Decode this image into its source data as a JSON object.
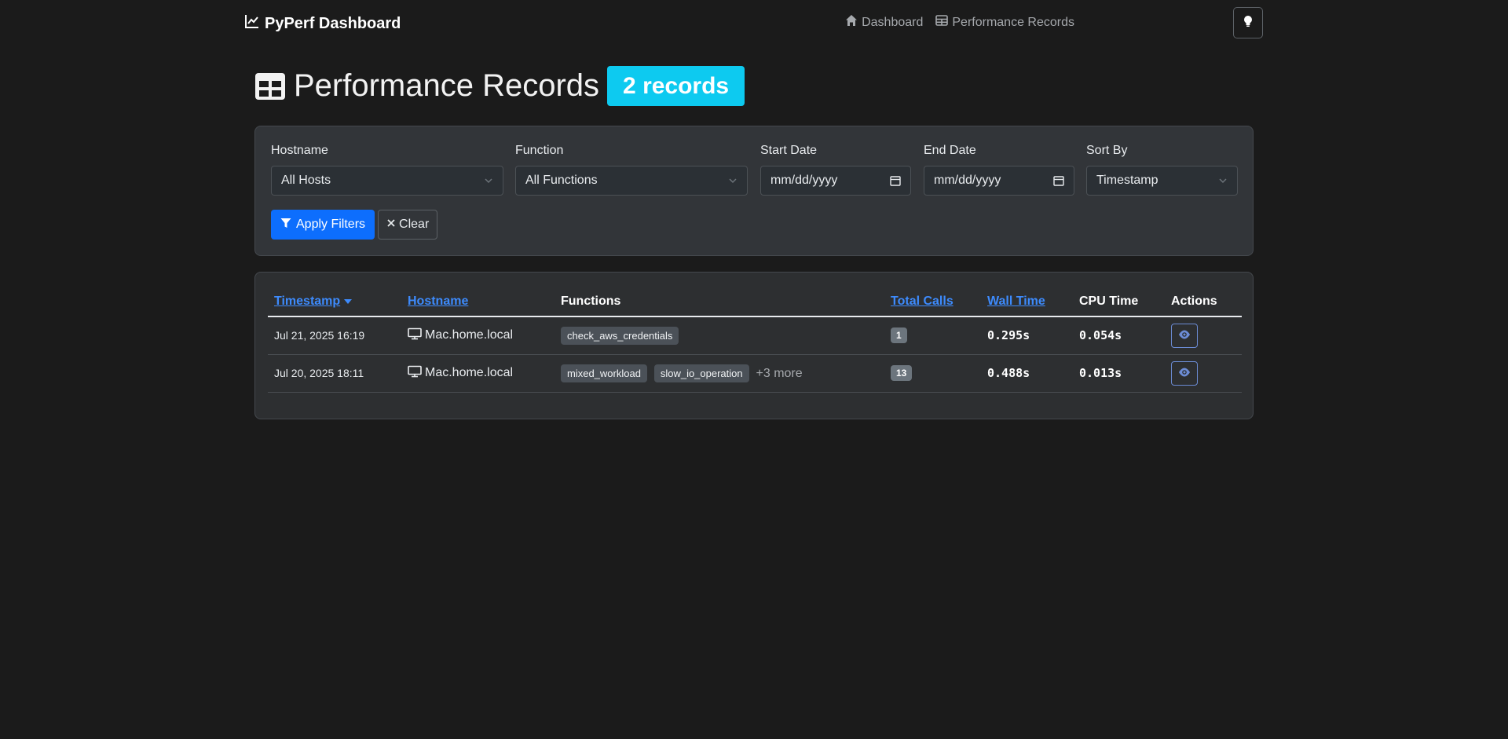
{
  "navbar": {
    "brand": "PyPerf Dashboard",
    "brand_icon": "chart-line-icon",
    "links": [
      {
        "label": "Dashboard",
        "icon": "home-icon"
      },
      {
        "label": "Performance Records",
        "icon": "table-icon"
      }
    ],
    "theme_toggle_icon": "lightbulb-icon"
  },
  "page": {
    "title": "Performance Records",
    "title_icon": "table-icon",
    "records_badge": "2 records"
  },
  "filters": {
    "hostname": {
      "label": "Hostname",
      "value": "All Hosts"
    },
    "function": {
      "label": "Function",
      "value": "All Functions"
    },
    "start_date": {
      "label": "Start Date",
      "placeholder": "mm/dd/yyyy"
    },
    "end_date": {
      "label": "End Date",
      "placeholder": "mm/dd/yyyy"
    },
    "sort_by": {
      "label": "Sort By",
      "value": "Timestamp"
    },
    "apply_label": "Apply Filters",
    "clear_label": "Clear"
  },
  "table": {
    "columns": {
      "timestamp": "Timestamp",
      "hostname": "Hostname",
      "functions": "Functions",
      "total_calls": "Total Calls",
      "wall_time": "Wall Time",
      "cpu_time": "CPU Time",
      "actions": "Actions"
    },
    "rows": [
      {
        "timestamp": "Jul 21, 2025 16:19",
        "hostname": "Mac.home.local",
        "functions": [
          "check_aws_credentials"
        ],
        "more": "",
        "total_calls": "1",
        "wall_time": "0.295s",
        "cpu_time": "0.054s"
      },
      {
        "timestamp": "Jul 20, 2025 18:11",
        "hostname": "Mac.home.local",
        "functions": [
          "mixed_workload",
          "slow_io_operation"
        ],
        "more": "+3 more",
        "total_calls": "13",
        "wall_time": "0.488s",
        "cpu_time": "0.013s"
      }
    ]
  },
  "colors": {
    "background": "#1b1b1b",
    "primary": "#0d6efd",
    "info_badge": "#0dcaf0",
    "link": "#3d8bfd"
  }
}
